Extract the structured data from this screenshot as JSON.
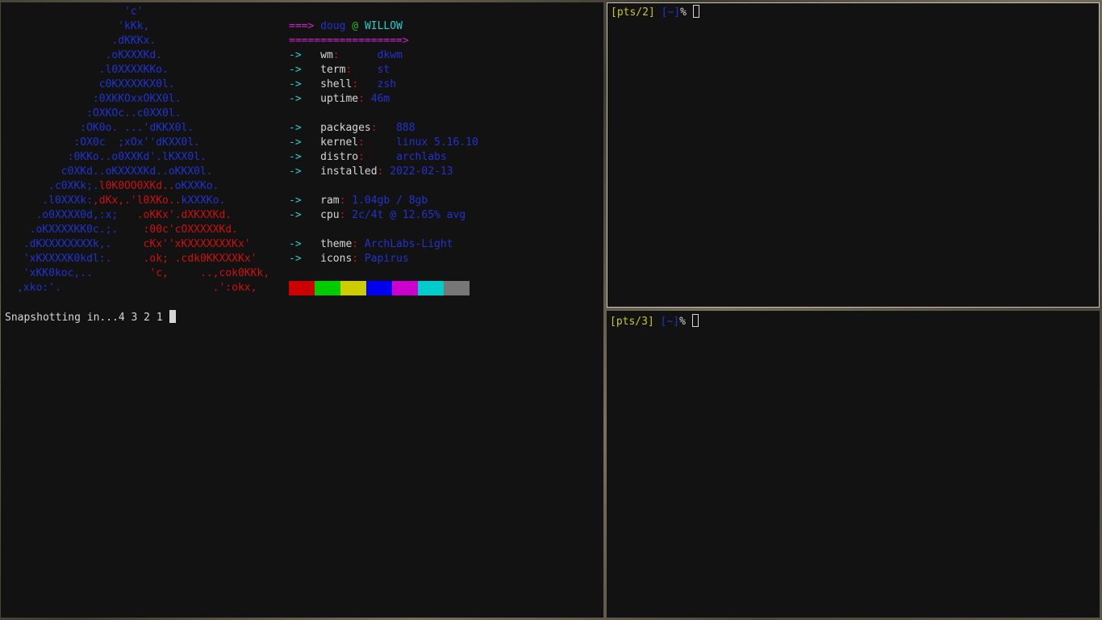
{
  "fetch": {
    "logo_lines": [
      {
        "parts": [
          {
            "t": "                 'c'",
            "c": "blue"
          }
        ]
      },
      {
        "parts": [
          {
            "t": "                'kKk,",
            "c": "blue"
          }
        ]
      },
      {
        "parts": [
          {
            "t": "               .dKKKx.",
            "c": "blue"
          }
        ]
      },
      {
        "parts": [
          {
            "t": "              .oKXXXKd.",
            "c": "blue"
          }
        ]
      },
      {
        "parts": [
          {
            "t": "             .l0XXXXKKo.",
            "c": "blue"
          }
        ]
      },
      {
        "parts": [
          {
            "t": "             c0KXXXXKX0l.",
            "c": "blue"
          }
        ]
      },
      {
        "parts": [
          {
            "t": "            :0XKKOxxOKX0l.",
            "c": "blue"
          }
        ]
      },
      {
        "parts": [
          {
            "t": "           :OXKOc..c0XX0l.",
            "c": "blue"
          }
        ]
      },
      {
        "parts": [
          {
            "t": "          :OK0o. ...'dKKX0l.",
            "c": "blue"
          }
        ]
      },
      {
        "parts": [
          {
            "t": "         :OX0c  ;xOx''dKXX0l.",
            "c": "blue"
          }
        ]
      },
      {
        "parts": [
          {
            "t": "        :0KKo..o0XXKd'.lKXX0l.",
            "c": "blue"
          }
        ]
      },
      {
        "parts": [
          {
            "t": "       c0XKd..oKXXXXKd..oKKX0l.",
            "c": "blue"
          }
        ]
      },
      {
        "parts": [
          {
            "t": "     .c0XKk;.",
            "c": "blue"
          },
          {
            "t": "l0K0OO0XKd..",
            "c": "red"
          },
          {
            "t": "oKXXKo.",
            "c": "blue"
          }
        ]
      },
      {
        "parts": [
          {
            "t": "    .l0XXXk:",
            "c": "blue"
          },
          {
            "t": ",dKx,.'l0XKo..",
            "c": "red"
          },
          {
            "t": "kXXXKo.",
            "c": "blue"
          }
        ]
      },
      {
        "parts": [
          {
            "t": "   .o0XXXX0d,:x;   ",
            "c": "blue"
          },
          {
            "t": ".oKKx'.dXKXXKd.",
            "c": "red"
          }
        ]
      },
      {
        "parts": [
          {
            "t": "  .oKXXXXKK0c.;.    ",
            "c": "blue"
          },
          {
            "t": ":00c'cOXXXXXKd.",
            "c": "red"
          }
        ]
      },
      {
        "parts": [
          {
            "t": " .dKXXXXXXXXk,.     ",
            "c": "blue"
          },
          {
            "t": "cKx''xKXXXXXXXKx'",
            "c": "red"
          }
        ]
      },
      {
        "parts": [
          {
            "t": " 'xKXXXXK0kdl:.     ",
            "c": "blue"
          },
          {
            "t": ".ok; .cdk0KKXXXKx'",
            "c": "red"
          }
        ]
      },
      {
        "parts": [
          {
            "t": " 'xKK0koc,..         ",
            "c": "blue"
          },
          {
            "t": "'c,     ..,cok0KKk,",
            "c": "red"
          }
        ]
      },
      {
        "parts": [
          {
            "t": ",xko:'.                        ",
            "c": "blue"
          },
          {
            "t": ".':okx,",
            "c": "red"
          }
        ]
      }
    ],
    "header": {
      "arrow": "===>",
      "user": "doug",
      "at": "@",
      "host": "WILLOW",
      "rule": "==================>"
    },
    "info_arrow": "->",
    "info": [
      {
        "row": 3,
        "key": "wm",
        "val": "dkwm"
      },
      {
        "row": 4,
        "key": "term",
        "val": "st"
      },
      {
        "row": 5,
        "key": "shell",
        "val": "zsh"
      },
      {
        "row": 6,
        "key": "uptime",
        "val": "46m"
      },
      {
        "row": 8,
        "key": "packages",
        "val": "888"
      },
      {
        "row": 9,
        "key": "kernel",
        "val": "linux 5.16.10"
      },
      {
        "row": 10,
        "key": "distro",
        "val": "archlabs"
      },
      {
        "row": 11,
        "key": "installed",
        "val": "2022-02-13"
      },
      {
        "row": 13,
        "key": "ram",
        "val": "1.04gb / 8gb"
      },
      {
        "row": 14,
        "key": "cpu",
        "val": "2c/4t @ 12.65% avg"
      },
      {
        "row": 16,
        "key": "theme",
        "val": "ArchLabs-Light"
      },
      {
        "row": 17,
        "key": "icons",
        "val": "Papirus"
      }
    ],
    "info_spacing": {
      "wm": "     ",
      "term": "   ",
      "shell": "  ",
      "uptime": "",
      "packages": "  ",
      "kernel": "    ",
      "distro": "    ",
      "installed": "",
      "ram": "",
      "cpu": "",
      "theme": "",
      "icons": ""
    },
    "swatch_colors": [
      "#cc0000",
      "#00cc00",
      "#cccc00",
      "#0000ee",
      "#cc00cc",
      "#00cccc",
      "#777777"
    ],
    "snapshot_text": "Snapshotting in...4 3 2 1 "
  },
  "pane2": {
    "pts": "pts/2",
    "dir": "~",
    "prompt": "%"
  },
  "pane3": {
    "pts": "pts/3",
    "dir": "~",
    "prompt": "%"
  }
}
